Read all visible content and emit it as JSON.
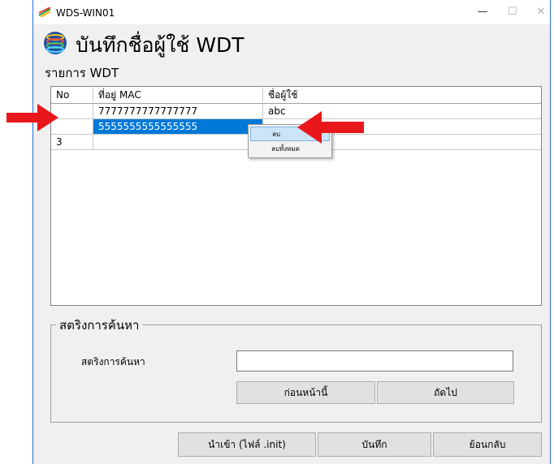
{
  "window": {
    "title": "WDS-WIN01",
    "minimize_glyph": "—",
    "maximize_glyph": "☐",
    "close_glyph": "✕"
  },
  "header": {
    "title": "บันทึกชื่อผู้ใช้ WDT",
    "icon": "stack-rings-icon"
  },
  "list_section": {
    "label": "รายการ WDT"
  },
  "grid": {
    "columns": [
      "No",
      "ที่อยู่ MAC",
      "ชื่อผู้ใช้"
    ],
    "rows": [
      {
        "no": "",
        "mac": "7777777777777777",
        "user": "abc"
      },
      {
        "no": "",
        "mac": "5555555555555555",
        "user": ""
      },
      {
        "no": "3",
        "mac": "",
        "user": ""
      }
    ],
    "selected_row": 1
  },
  "context_menu": {
    "items": [
      "ลบ",
      "ลบทั้งหมด"
    ],
    "highlighted": 0
  },
  "search": {
    "group_title": "สตริงการค้นหา",
    "label": "สตริงการค้นหา",
    "value": "",
    "prev_label": "ก่อนหน้านี้",
    "next_label": "ถัดไป"
  },
  "footer": {
    "import_label": "นำเข้า (ไฟล์ .init)",
    "save_label": "บันทึก",
    "back_label": "ย้อนกลับ"
  },
  "colors": {
    "selection": "#0078d7",
    "annotation_arrow": "#e8171c",
    "window_border": "#1e6fd9"
  }
}
